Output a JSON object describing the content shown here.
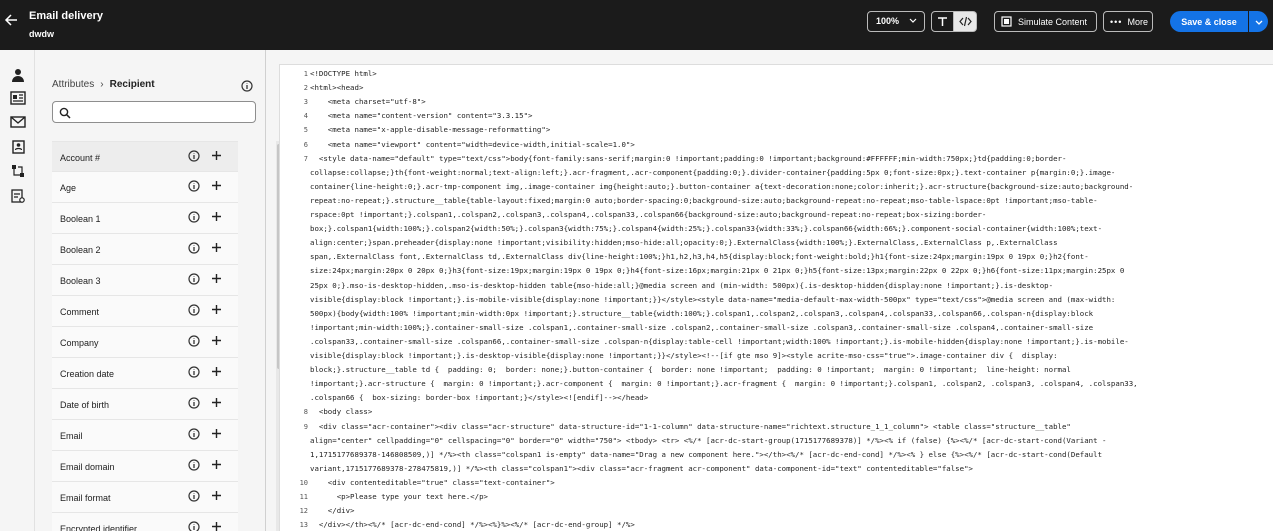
{
  "header": {
    "title": "Email delivery",
    "subtitle": "dwdw",
    "zoom": "100%",
    "simulate_label": "Simulate Content",
    "more_label": "More",
    "save_label": "Save & close"
  },
  "panel": {
    "breadcrumb_parent": "Attributes",
    "breadcrumb_current": "Recipient",
    "search_placeholder": "",
    "items": [
      {
        "label": "Account #"
      },
      {
        "label": "Age"
      },
      {
        "label": "Boolean 1"
      },
      {
        "label": "Boolean 2"
      },
      {
        "label": "Boolean 3"
      },
      {
        "label": "Comment"
      },
      {
        "label": "Company"
      },
      {
        "label": "Creation date"
      },
      {
        "label": "Date of birth"
      },
      {
        "label": "Email"
      },
      {
        "label": "Email domain"
      },
      {
        "label": "Email format"
      },
      {
        "label": "Encrypted identifier"
      }
    ]
  },
  "editor": {
    "line_numbers": [
      "1",
      "2",
      "3",
      "4",
      "5",
      "6",
      "7",
      "8",
      "9",
      "10",
      "11",
      "12",
      "13"
    ],
    "lines": [
      "<!DOCTYPE html>",
      "<html><head>",
      "    <meta charset=\"utf-8\">",
      "    <meta name=\"content-version\" content=\"3.3.15\">",
      "    <meta name=\"x-apple-disable-message-reformatting\">",
      "    <meta name=\"viewport\" content=\"width=device-width,initial-scale=1.0\">",
      "  <style data-name=\"default\" type=\"text/css\">body{font-family:sans-serif;margin:0 !important;padding:0 !important;background:#FFFFFF;min-width:750px;}td{padding:0;border-",
      "collapse:collapse;}th{font-weight:normal;text-align:left;}.acr-fragment,.acr-component{padding:0;}.divider-container{padding:5px 0;font-size:0px;}.text-container p{margin:0;}.image-",
      "container{line-height:0;}.acr-tmp-component img,.image-container img{height:auto;}.button-container a{text-decoration:none;color:inherit;}.acr-structure{background-size:auto;background-",
      "repeat:no-repeat;}.structure__table{table-layout:fixed;margin:0 auto;border-spacing:0;background-size:auto;background-repeat:no-repeat;mso-table-lspace:0pt !important;mso-table-",
      "rspace:0pt !important;}.colspan1,.colspan2,.colspan3,.colspan4,.colspan33,.colspan66{background-size:auto;background-repeat:no-repeat;box-sizing:border-",
      "box;}.colspan1{width:100%;}.colspan2{width:50%;}.colspan3{width:75%;}.colspan4{width:25%;}.colspan33{width:33%;}.colspan66{width:66%;}.component-social-container{width:100%;text-",
      "align:center;}span.preheader{display:none !important;visibility:hidden;mso-hide:all;opacity:0;}.ExternalClass{width:100%;}.ExternalClass,.ExternalClass p,.ExternalClass",
      "span,.ExternalClass font,.ExternalClass td,.ExternalClass div{line-height:100%;}h1,h2,h3,h4,h5{display:block;font-weight:bold;}h1{font-size:24px;margin:19px 0 19px 0;}h2{font-",
      "size:24px;margin:20px 0 20px 0;}h3{font-size:19px;margin:19px 0 19px 0;}h4{font-size:16px;margin:21px 0 21px 0;}h5{font-size:13px;margin:22px 0 22px 0;}h6{font-size:11px;margin:25px 0",
      "25px 0;}.mso-is-desktop-hidden,.mso-is-desktop-hidden table{mso-hide:all;}@media screen and (min-width: 500px){.is-desktop-hidden{display:none !important;}.is-desktop-",
      "visible{display:block !important;}.is-mobile-visible{display:none !important;}}</style><style data-name=\"media-default-max-width-500px\" type=\"text/css\">@media screen and (max-width:",
      "500px){body{width:100% !important;min-width:0px !important;}.structure__table{width:100%;}.colspan1,.colspan2,.colspan3,.colspan4,.colspan33,.colspan66,.colspan-n{display:block",
      "!important;min-width:100%;}.container-small-size .colspan1,.container-small-size .colspan2,.container-small-size .colspan3,.container-small-size .colspan4,.container-small-size",
      ".colspan33,.container-small-size .colspan66,.container-small-size .colspan-n{display:table-cell !important;width:100% !important;}.is-mobile-hidden{display:none !important;}.is-mobile-",
      "visible{display:block !important;}.is-desktop-visible{display:none !important;}}</style><!--[if gte mso 9]><style acrite-mso-css=\"true\">.image-container div {  display:",
      "block;}.structure__table td {  padding: 0;  border: none;}.button-container {  border: none !important;  padding: 0 !important;  margin: 0 !important;  line-height: normal",
      "!important;}.acr-structure {  margin: 0 !important;}.acr-component {  margin: 0 !important;}.acr-fragment {  margin: 0 !important;}.colspan1, .colspan2, .colspan3, .colspan4, .colspan33,",
      ".colspan66 {  box-sizing: border-box !important;}</style><![endif]--></head>",
      "  <body class>",
      "  <div class=\"acr-container\"><div class=\"acr-structure\" data-structure-id=\"1-1-column\" data-structure-name=\"richtext.structure_1_1_column\"> <table class=\"structure__table\"",
      "align=\"center\" cellpadding=\"0\" cellspacing=\"0\" border=\"0\" width=\"750\"> <tbody> <tr> <%/* [acr-dc-start-group(1715177689378)] */%><% if (false) {%><%/* [acr-dc-start-cond(Variant -",
      "1,1715177689378-146808509,)] */%><th class=\"colspan1 is-empty\" data-name=\"Drag a new component here.\"></th><%/* [acr-dc-end-cond] */%><% } else {%><%/* [acr-dc-start-cond(Default",
      "variant,1715177689378-278475819,)] */%><th class=\"colspan1\"><div class=\"acr-fragment acr-component\" data-component-id=\"text\" contenteditable=\"false\">",
      "    <div contenteditable=\"true\" class=\"text-container\">",
      "      <p>Please type your text here.</p>",
      "    </div>",
      "  </div></th><%/* [acr-dc-end-cond] */%><%}%><%/* [acr-dc-end-group] */%>"
    ]
  }
}
